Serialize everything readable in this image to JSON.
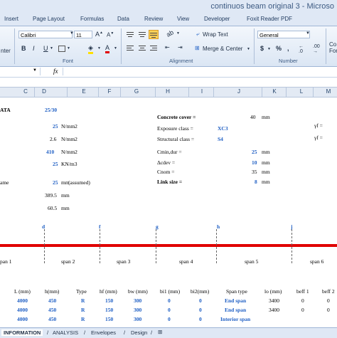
{
  "window": {
    "title": "continuos beam original 3 - Microso"
  },
  "ribbon_tabs": [
    "Insert",
    "Page Layout",
    "Formulas",
    "Data",
    "Review",
    "View",
    "Developer",
    "Foxit Reader PDF"
  ],
  "ribbon": {
    "clipboard_label": "nter",
    "font_name": "Calibri",
    "font_size": "11",
    "bold": "B",
    "italic": "I",
    "underline": "U",
    "font_group": "Font",
    "wrap_text": "Wrap Text",
    "merge_center": "Merge & Center",
    "alignment_group": "Alignment",
    "number_format": "General",
    "currency": "$",
    "percent": "%",
    "number_group": "Number",
    "cond_format_a": "Co",
    "cond_format_b": "Form",
    "fx": "fx"
  },
  "columns": [
    "C",
    "D",
    "E",
    "F",
    "G",
    "H",
    "I",
    "J",
    "K",
    "L",
    "M"
  ],
  "colors": {
    "accent_blue": "#1f5fc4",
    "beam_red": "#e00000",
    "header_bg": "#e3eaf4"
  },
  "sheet": {
    "left_title": "ATA",
    "concrete_class": "25/30",
    "v1": "25",
    "u1": "N/mm2",
    "v2": "2.6",
    "u2": "N/mm2",
    "v3": "410",
    "u3": "N/mm2",
    "v4": "25",
    "u4": "KN/m3",
    "ame": "ame",
    "v5": "25",
    "u5": "mm",
    "assumed": "(assumed)",
    "v6": "389.5",
    "u6": "mm",
    "v7": "60.5",
    "u7": "mm",
    "cover_label": "Concrete cover =",
    "cover_value": "40",
    "cover_unit": "mm",
    "exposure_label": "Exposure class  =",
    "exposure_value": "XC3",
    "structural_label": "Structural class =",
    "structural_value": "S4",
    "cmin_label": "Cmin,dur  =",
    "cmin_value": "25",
    "cmin_unit": "mm",
    "dcdev_label": "Δcdev       =",
    "dcdev_value": "10",
    "dcdev_unit": "mm",
    "cnom_label": "Cnom        =",
    "cnom_value": "35",
    "cnom_unit": "mm",
    "link_label": "Link size       =",
    "link_value": "8",
    "link_unit": "mm",
    "gamma_f1": "γf =",
    "gamma_f2": "γf ="
  },
  "beam": {
    "supports": [
      "d",
      "f",
      "g",
      "h",
      "j"
    ],
    "spans": [
      "pan 1",
      "span 2",
      "span 3",
      "span 4",
      "span 5",
      "span 6"
    ]
  },
  "table": {
    "headers": [
      "L (mm)",
      "h(mm)",
      "Type",
      "hf (mm)",
      "bw (mm)",
      "bi1 (mm)",
      "bi2(mm)",
      "Span type",
      "lo (mm)",
      "beff 1",
      "beff 2"
    ],
    "rows": [
      [
        "4000",
        "450",
        "R",
        "150",
        "300",
        "0",
        "0",
        "End span",
        "3400",
        "0",
        "0"
      ],
      [
        "4000",
        "450",
        "R",
        "150",
        "300",
        "0",
        "0",
        "End span",
        "3400",
        "0",
        "0"
      ],
      [
        "4000",
        "450",
        "R",
        "150",
        "300",
        "0",
        "0",
        "Interior span",
        "",
        "",
        ""
      ]
    ]
  },
  "sheet_tabs": [
    "INFORMATION",
    "ANALYSIS",
    "Envelopes",
    "Design"
  ]
}
